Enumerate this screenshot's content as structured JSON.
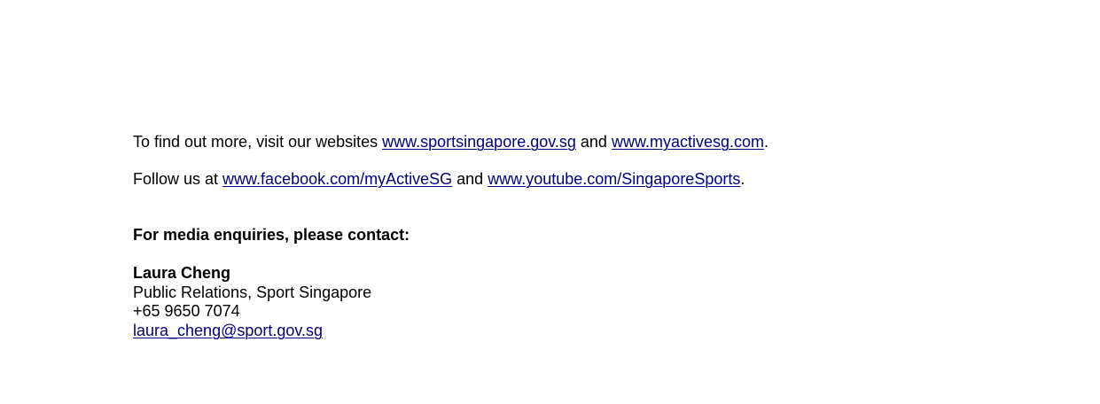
{
  "websites": {
    "prefix": "To find out more, visit our websites ",
    "link1": "www.sportsingapore.gov.sg",
    "middle": " and ",
    "link2": "www.myactivesg.com",
    "suffix": "."
  },
  "social": {
    "prefix": "Follow us at ",
    "link1": "www.facebook.com/myActiveSG",
    "middle": " and ",
    "link2": "www.youtube.com/SingaporeSports",
    "suffix": "."
  },
  "media": {
    "heading": "For media enquiries, please contact:",
    "contact_name": "Laura Cheng",
    "contact_title": "Public Relations, Sport Singapore",
    "contact_phone": "+65 9650 7074",
    "contact_email": "laura_cheng@sport.gov.sg"
  },
  "colors": {
    "link": "#000080",
    "text": "#000000"
  }
}
